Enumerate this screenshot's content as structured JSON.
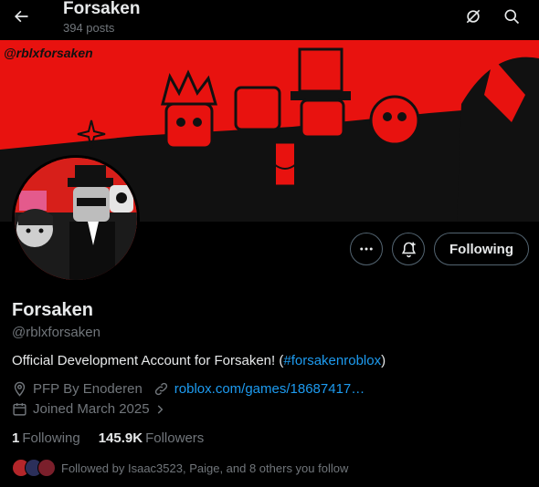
{
  "header": {
    "title": "Forsaken",
    "posts": "394 posts"
  },
  "banner": {
    "watermark": "@rblxforsaken",
    "background": "#e8120f"
  },
  "profile": {
    "name": "Forsaken",
    "handle": "@rblxforsaken",
    "bio_text": "Official Development Account for Forsaken! (",
    "bio_hashtag": "#forsakenroblox",
    "bio_end": ")",
    "pfp_credit": "PFP By Enoderen",
    "website": "roblox.com/games/18687417…",
    "joined": "Joined March 2025"
  },
  "actions": {
    "following_label": "Following"
  },
  "stats": {
    "following_count": "1",
    "following_label": "Following",
    "followers_count": "145.9K",
    "followers_label": "Followers"
  },
  "followed_by": {
    "text": "Followed by Isaac3523, Paige, and 8 others you follow"
  },
  "colors": {
    "accent": "#1d9bf0",
    "muted": "#71767b",
    "text": "#e7e9ea"
  }
}
